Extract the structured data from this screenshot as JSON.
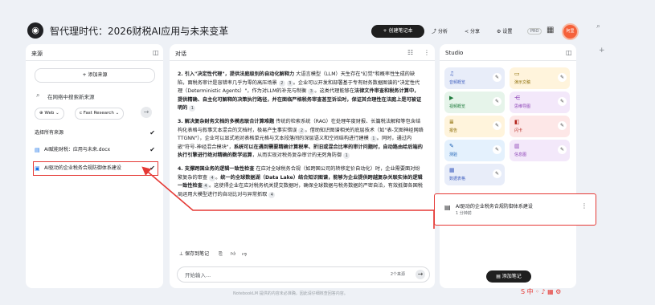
{
  "header": {
    "logo": "◉",
    "title": "智代理时代：2026财税AI应用与未来变革",
    "create_button": "+ 创建笔记本",
    "analyze": "分析",
    "share": "分享",
    "settings": "设置",
    "pro": "PRO",
    "avatar": "阿里"
  },
  "sources": {
    "header": "来源",
    "add_button": "+ 添加来源",
    "search_placeholder": "在网络中搜索新来源",
    "chip_web": "Web",
    "chip_research": "Fast Research",
    "select_all": "选择所有来源",
    "items": [
      {
        "label": "AI赋能财税：应用与未来.docx",
        "icon": "doc-icon"
      },
      {
        "label": "AI驱动的企业税务合规防御体系建设",
        "icon": "note-icon"
      }
    ]
  },
  "chat": {
    "header": "对话",
    "p1_pre": "2. 引入\"决定性代理\"，",
    "p1_bold": "提供法庭级别的自动化解释力",
    "p1_rest": " 大语言模型（LLM）天生存在\"幻觉\"和概率性生成的缺陷，面税务审计是容错率几乎为零的高压场景 ",
    "p1_rest2": "。企业可以开发和部署基于专有财务数据图谱的\"决定性代理（Deterministic Agents）\"，作为对LLM的补充与制衡 ",
    "p1_rest3": "。这类代理能够在",
    "p1_bold2": "法律文件审查和税务计算中，提供精确、自主化可解释的决策执行路径，并在面临严格税务审查甚至诉讼时，保证其合理性在法庭上是可被证明的",
    "p2_bold": "3. 解决复杂财务文档的多模态联合计算难题",
    "p2_rest": " 传统的检索系统（RAG）在处理年度财报、长篇税法解释等包含结构化表格与叙事文本混合的文档时，极易产生事实错误 ",
    "p2_rest2": "。借助知识图谱相关的底层技术（如\"表-文图神经网络TTGNN\"），企业可以显式地对表格单元格与文本段落间的深层语义和空间结构进行建模 ",
    "p2_rest3": "。同时，通过内嵌\"符号-神经混合模块\"，",
    "p2_bold2": "系统可以在遇到需要精确计算税率、折旧或混合比率的审计问题时，自动路由给后端的执行引擎进行绝对精确的数学运算",
    "p2_rest4": "，从而实现对税务复杂审计的无死角防御 ",
    "p3_bold": "4. 支撑跨国业务的逻辑一致性检查",
    "p3_rest": " 在应对全球税务合规（如跨国公司的转移定价自动化）时，企业需要面对纷繁复杂的审查 ",
    "p3_rest2": "。",
    "p3_bold2": "统一的全球数据湖（Data Lake）结合知识图谱，能够为企业提供跨越复杂关联实体的逻辑一致性检查",
    "p3_rest3": "。这使得企业在应对税务机关提交数据时，确保全球数据与税务数据的严密自洽，有效抵御各国税局运用大模型进行的自动比对与异常抓取 ",
    "cites": [
      "2",
      "3",
      "3",
      "1",
      "2",
      "1",
      "1",
      "4",
      "4",
      "4"
    ],
    "save_note": "保存到笔记",
    "input_placeholder": "开始输入...",
    "source_count": "2个来源",
    "footer": "NotebookLM 提供的内容未必准确，因此请仔细核查回答内容。"
  },
  "studio": {
    "header": "Studio",
    "tiles": [
      {
        "label": "音频概览",
        "icon": "audio-icon",
        "bg": "#e8edf9",
        "fg": "#3f5fbf"
      },
      {
        "label": "演示文稿",
        "icon": "slides-icon",
        "bg": "#fff4dc",
        "fg": "#8a6a00"
      },
      {
        "label": "视频概览",
        "icon": "video-icon",
        "bg": "#e6f4ea",
        "fg": "#1e7a3c"
      },
      {
        "label": "思维导图",
        "icon": "mindmap-icon",
        "bg": "#f3e8fa",
        "fg": "#8a3fb5"
      },
      {
        "label": "报告",
        "icon": "report-icon",
        "bg": "#fff4dc",
        "fg": "#8a6a00"
      },
      {
        "label": "闪卡",
        "icon": "flashcard-icon",
        "bg": "#fde7e7",
        "fg": "#b3261e"
      },
      {
        "label": "测验",
        "icon": "quiz-icon",
        "bg": "#e4f1fd",
        "fg": "#1a5fb4"
      },
      {
        "label": "信息图",
        "icon": "infographic-icon",
        "bg": "#f3e8fa",
        "fg": "#8a3fb5"
      },
      {
        "label": "数据表格",
        "icon": "table-icon",
        "bg": "#e8edf9",
        "fg": "#3f5fbf"
      }
    ],
    "note_title": "AI驱动的企业税务合规防御体系建设",
    "note_sub": "1 分钟前",
    "add_note": "添加笔记"
  }
}
